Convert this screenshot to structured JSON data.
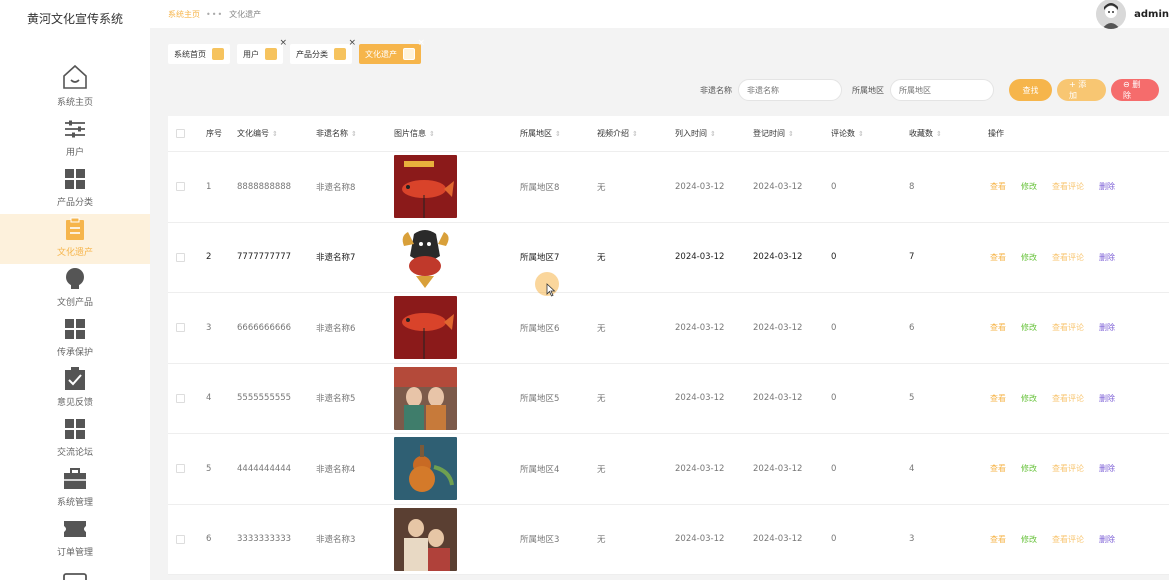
{
  "app_title": "黄河文化宣传系统",
  "breadcrumb": {
    "home": "系统主页",
    "sep": "•••",
    "current": "文化遗产"
  },
  "user": {
    "name": "admin"
  },
  "sidebar": {
    "items": [
      {
        "label": "系统主页",
        "icon": "home-icon"
      },
      {
        "label": "用户",
        "icon": "sliders-icon"
      },
      {
        "label": "产品分类",
        "icon": "grid-icon"
      },
      {
        "label": "文化遗产",
        "icon": "clipboard-icon"
      },
      {
        "label": "文创产品",
        "icon": "bulb-icon"
      },
      {
        "label": "传承保护",
        "icon": "grid-icon"
      },
      {
        "label": "意见反馈",
        "icon": "check-box-icon"
      },
      {
        "label": "交流论坛",
        "icon": "grid-icon"
      },
      {
        "label": "系统管理",
        "icon": "briefcase-icon"
      },
      {
        "label": "订单管理",
        "icon": "ticket-icon"
      }
    ]
  },
  "tabs": [
    {
      "label": "系统首页",
      "closable": false
    },
    {
      "label": "用户",
      "closable": true
    },
    {
      "label": "产品分类",
      "closable": true
    },
    {
      "label": "文化遗产",
      "closable": true
    }
  ],
  "search": {
    "name_label": "非遗名称",
    "name_placeholder": "非遗名称",
    "region_label": "所属地区",
    "region_placeholder": "所属地区",
    "search_btn": "查找",
    "add_btn": "+ 添加",
    "delete_btn": "⊖ 删除"
  },
  "table": {
    "headers": [
      "序号",
      "文化编号",
      "非遗名称",
      "图片信息",
      "所属地区",
      "视频介绍",
      "列入时间",
      "登记时间",
      "评论数",
      "收藏数",
      "操作"
    ],
    "rows": [
      {
        "index": "1",
        "code": "8888888888",
        "name": "非遗名称8",
        "region": "所属地区8",
        "video": "无",
        "listed": "2024-03-12",
        "registered": "2024-03-12",
        "comments": "0",
        "favorites": "8"
      },
      {
        "index": "2",
        "code": "7777777777",
        "name": "非遗名称7",
        "region": "所属地区7",
        "video": "无",
        "listed": "2024-03-12",
        "registered": "2024-03-12",
        "comments": "0",
        "favorites": "7"
      },
      {
        "index": "3",
        "code": "6666666666",
        "name": "非遗名称6",
        "region": "所属地区6",
        "video": "无",
        "listed": "2024-03-12",
        "registered": "2024-03-12",
        "comments": "0",
        "favorites": "6"
      },
      {
        "index": "4",
        "code": "5555555555",
        "name": "非遗名称5",
        "region": "所属地区5",
        "video": "无",
        "listed": "2024-03-12",
        "registered": "2024-03-12",
        "comments": "0",
        "favorites": "5"
      },
      {
        "index": "5",
        "code": "4444444444",
        "name": "非遗名称4",
        "region": "所属地区4",
        "video": "无",
        "listed": "2024-03-12",
        "registered": "2024-03-12",
        "comments": "0",
        "favorites": "4"
      },
      {
        "index": "6",
        "code": "3333333333",
        "name": "非遗名称3",
        "region": "所属地区3",
        "video": "无",
        "listed": "2024-03-12",
        "registered": "2024-03-12",
        "comments": "0",
        "favorites": "3"
      }
    ],
    "actions": {
      "view": "查看",
      "edit": "修改",
      "comments": "查看评论",
      "delete": "删除"
    }
  },
  "colors": {
    "accent": "#f6b54b",
    "edit": "#67c23a",
    "delete": "#7c5fd6",
    "danger": "#f56c6c"
  }
}
